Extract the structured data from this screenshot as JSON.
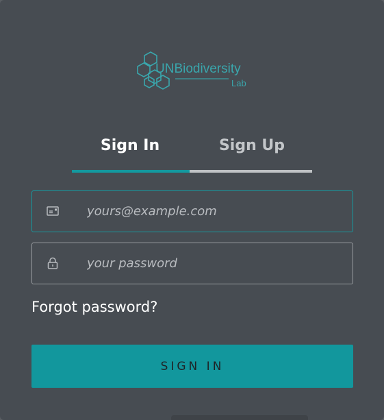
{
  "logo": {
    "name_prefix": "UN",
    "name_main": "Biodiversity",
    "sub": "Lab",
    "brand_color": "#3aa6ac"
  },
  "tabs": [
    {
      "label": "Sign In",
      "active": true
    },
    {
      "label": "Sign Up",
      "active": false
    }
  ],
  "form": {
    "email": {
      "placeholder": "yours@example.com",
      "value": "",
      "icon": "envelope-icon"
    },
    "password": {
      "placeholder": "your password",
      "value": "",
      "icon": "lock-icon"
    },
    "forgot_label": "Forgot password?",
    "submit_label": "SIGN IN"
  },
  "colors": {
    "background": "#474c52",
    "accent": "#12979d",
    "text": "#ffffff"
  }
}
